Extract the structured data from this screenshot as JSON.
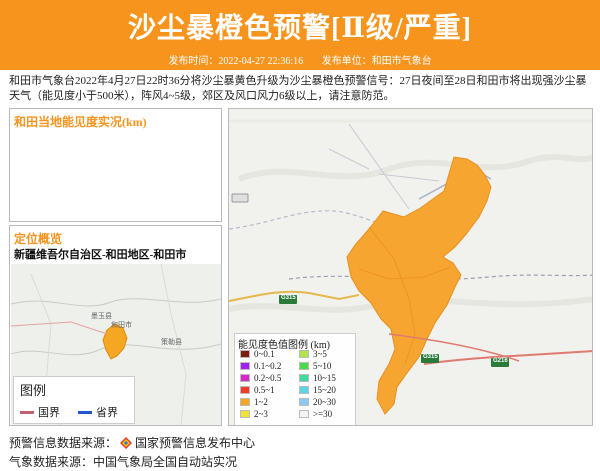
{
  "banner": {
    "title": "沙尘暴橙色预警[Ⅱ级/严重]",
    "publish_time_label": "发布时间：2022-04-27 22:36:16",
    "publisher_label": "发布单位：和田市气象台",
    "color": "#f7941d"
  },
  "description": "和田市气象台2022年4月27日22时36分将沙尘暴黄色升级为沙尘暴橙色预警信号：27日夜间至28日和田市将出现强沙尘暴天气（能见度小于500米），阵风4~5级，郊区及风口风力6级以上，请注意防范。",
  "visibility_panel": {
    "title": "和田当地能见度实况(km)"
  },
  "location_panel": {
    "title": "定位概览",
    "region": "新疆维吾尔自治区-和田地区-和田市",
    "legend_title": "图例",
    "legend_items": [
      {
        "label": "国界",
        "color": "#c06070"
      },
      {
        "label": "省界",
        "color": "#2255cc"
      }
    ],
    "map_labels": [
      "墨玉县",
      "和田市",
      "策勒县"
    ]
  },
  "main_map": {
    "road_labels": [
      "G315",
      "G216",
      "G315"
    ],
    "legend_title": "能见度色值图例 (km)",
    "legend_items": [
      {
        "label": "0~0.1",
        "color": "#7a1e0e"
      },
      {
        "label": "3~5",
        "color": "#b3e34a"
      },
      {
        "label": "0.1~0.2",
        "color": "#a020f0"
      },
      {
        "label": "5~10",
        "color": "#4cd94c"
      },
      {
        "label": "0.2~0.5",
        "color": "#d629c7"
      },
      {
        "label": "10~15",
        "color": "#3ddc9e"
      },
      {
        "label": "0.5~1",
        "color": "#f03a2a"
      },
      {
        "label": "15~20",
        "color": "#5bd4e6"
      },
      {
        "label": "1~2",
        "color": "#f5a623"
      },
      {
        "label": "20~30",
        "color": "#8ec8f0"
      },
      {
        "label": "2~3",
        "color": "#f2e33a"
      },
      {
        "label": ">=30",
        "color": "#f4f4f4"
      }
    ]
  },
  "footer": {
    "warning_source_label": "预警信息数据来源：",
    "warning_source": "国家预警信息发布中心",
    "weather_source": "气象数据来源：中国气象局全国自动站实况"
  }
}
